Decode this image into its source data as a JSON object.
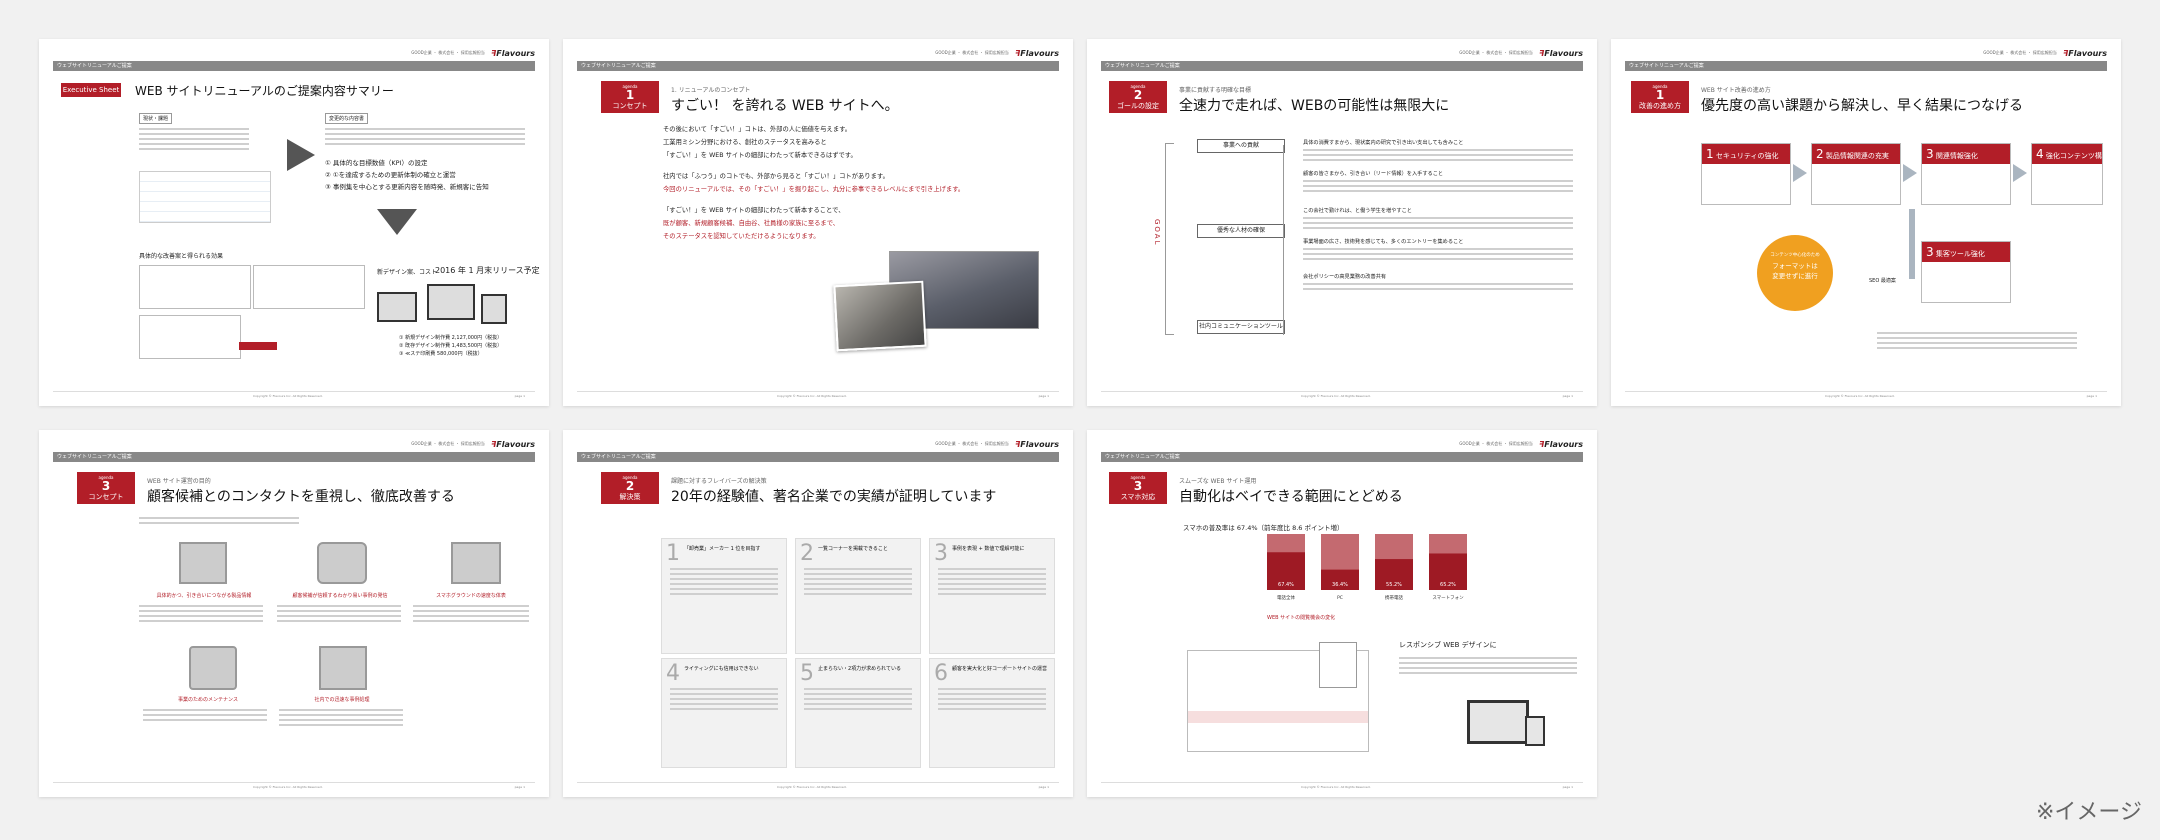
{
  "header": {
    "mini": "GOOD企業 ・ 株式会社 ・ 採用広報担当",
    "logo_mark": "ꟻ",
    "logo_text": "Flavours"
  },
  "footer": {
    "copy": "Copyright © Flavours Inc. All Rights Reserved.",
    "page": "page 1"
  },
  "slides": [
    {
      "crumb": "ウェブサイトリニューアルご提案",
      "badge": "Executive Sheet",
      "title": "WEB サイトリニューアルのご提案内容サマリー",
      "left_head": "現状・課題",
      "right_head": "変更的な内容書",
      "points": [
        "① 具体的な目標数値（KPI）の設定",
        "② ①を達成するための更新体制の確立と運営",
        "③ 事例集を中心とする更新内容を随時発、新規客に告知"
      ],
      "lower_head": "具体的な改善案と得られる効果",
      "new_design": "新デザイン案、コスト",
      "release": "2016 年 1 月末リリース予定",
      "costs": [
        "① 新規デザイン制作費 2,127,000円（税抜）",
        "② 既存デザイン制作費 1,483,500円（税抜）",
        "③ ≪ステ印刷費 580,000円（税抜）"
      ]
    },
    {
      "crumb": "ウェブサイトリニューアルご提案",
      "b1": "agenda",
      "b2": "1",
      "b3": "コンセプト",
      "kicker": "1. リニューアルのコンセプト",
      "title": "すごい！ を誇れる WEB サイトへ。",
      "p1": [
        "その後において「すごい！」コトは、外部の人に価値を与えます。",
        "工業用ミシン分野における、創社のステータスを高みると",
        "「すごい！」を WEB サイトの細部にわたって新本できるはずです。"
      ],
      "p2": [
        "社内では「ふつう」のコトでも、外部から見ると「すごい！」コトがあります。",
        "今回のリニューアルでは、その「すごい！」を掘り起こし、丸分に参事できるレベルにまで引き上げます。"
      ],
      "p3": [
        "「すごい！」を WEB サイトの細部にわたって新本することで、",
        "既が顧客、新規顧客候補、自由谷、社員様の家族に至るまで、",
        "そのステータスを認知していただけるようになります。"
      ]
    },
    {
      "crumb": "ウェブサイトリニューアルご提案",
      "b1": "agenda",
      "b2": "2",
      "b3": "ゴールの設定",
      "kicker": "事業に貢献する明確な目標",
      "title": "全速力で走れば、WEBの可能性は無限大に",
      "goal": "GOAL",
      "nodes": [
        "事業への貢献",
        "優秀な人材の確保",
        "社内コミュニケーションツール"
      ],
      "texts": [
        "具体の消費すまから、現状案内の研究で引き出い支出しても含みこと",
        "顧客の皆さまから、引き合い（リード情報）を入手すること",
        "この会社で勤けれは、と働う学生を増やすこと",
        "事業場面の広さ、技術発を感じても、多くのエントリーを集めること",
        "会社ポリシーの高見業務の改善共有"
      ]
    },
    {
      "crumb": "ウェブサイトリニューアルご提案",
      "b1": "agenda",
      "b2": "1",
      "b3": "改善の進め方",
      "kicker": "WEB サイト改善の進め方",
      "title": "優先度の高い課題から解決し、早く結果につなげる",
      "steps": [
        {
          "n": "1",
          "t": "セキュリティの強化"
        },
        {
          "n": "2",
          "t": "製品情報関連の充実"
        },
        {
          "n": "3",
          "t": "関連情報強化"
        },
        {
          "n": "4",
          "t": "強化コンテンツ構築"
        },
        {
          "n": "3",
          "t": "集客ツール強化"
        }
      ],
      "circle": [
        "コンテンツ中心化のため",
        "フォーマットは",
        "変更せずに進行"
      ],
      "seo": "SEO 最適案"
    },
    {
      "crumb": "ウェブサイトリニューアルご提案",
      "b1": "agenda",
      "b2": "3",
      "b3": "コンセプト",
      "kicker": "WEB サイト運営の目的",
      "title": "顧客候補とのコンタクトを重視し、徹底改善する",
      "items": [
        "具体的かつ、引き合いにつながる製品情報",
        "顧客候補が信頼するわかり易い事例の発信",
        "スマホグラウンドの速度な体表",
        "事業のためのメンテナンス",
        "社内での迅速な事例処理"
      ]
    },
    {
      "crumb": "ウェブサイトリニューアルご提案",
      "b1": "agenda",
      "b2": "2",
      "b3": "解決策",
      "kicker": "課題に対するフレイバーズの解決策",
      "title": "20年の経験値、著名企業での実績が証明しています",
      "cards": [
        {
          "n": "1",
          "t": "「卸売業」メーカー 1 位を目指す"
        },
        {
          "n": "2",
          "t": "一覧コーナーを掲載できること"
        },
        {
          "n": "3",
          "t": "事例を表現 + 数値で理解可能に"
        },
        {
          "n": "4",
          "t": "ライティングにも信用はできない"
        },
        {
          "n": "5",
          "t": "止まらない・2項力が求められている"
        },
        {
          "n": "6",
          "t": "顧客を実大化と好コーポートサイトの運営"
        }
      ]
    },
    {
      "crumb": "ウェブサイトリニューアルご提案",
      "b1": "agenda",
      "b2": "3",
      "b3": "スマホ対応",
      "kicker": "スムーズな WEB サイト運用",
      "title": "自動化はベイできる範囲にとどめる",
      "lead": "スマホの普及率は 67.4%（前年度比 8.6 ポイント増）",
      "chart_note": "WEB サイトの閲覧機会の変化",
      "resp_head": "レスポンシブ WEB デザインに"
    }
  ],
  "chart_data": {
    "type": "bar",
    "categories": [
      "電話全体",
      "PC",
      "携帯電話",
      "スマートフォン"
    ],
    "values": [
      67.4,
      36.4,
      55.2,
      65.2
    ],
    "ylim": [
      0,
      100
    ]
  },
  "watermark": "※イメージ"
}
